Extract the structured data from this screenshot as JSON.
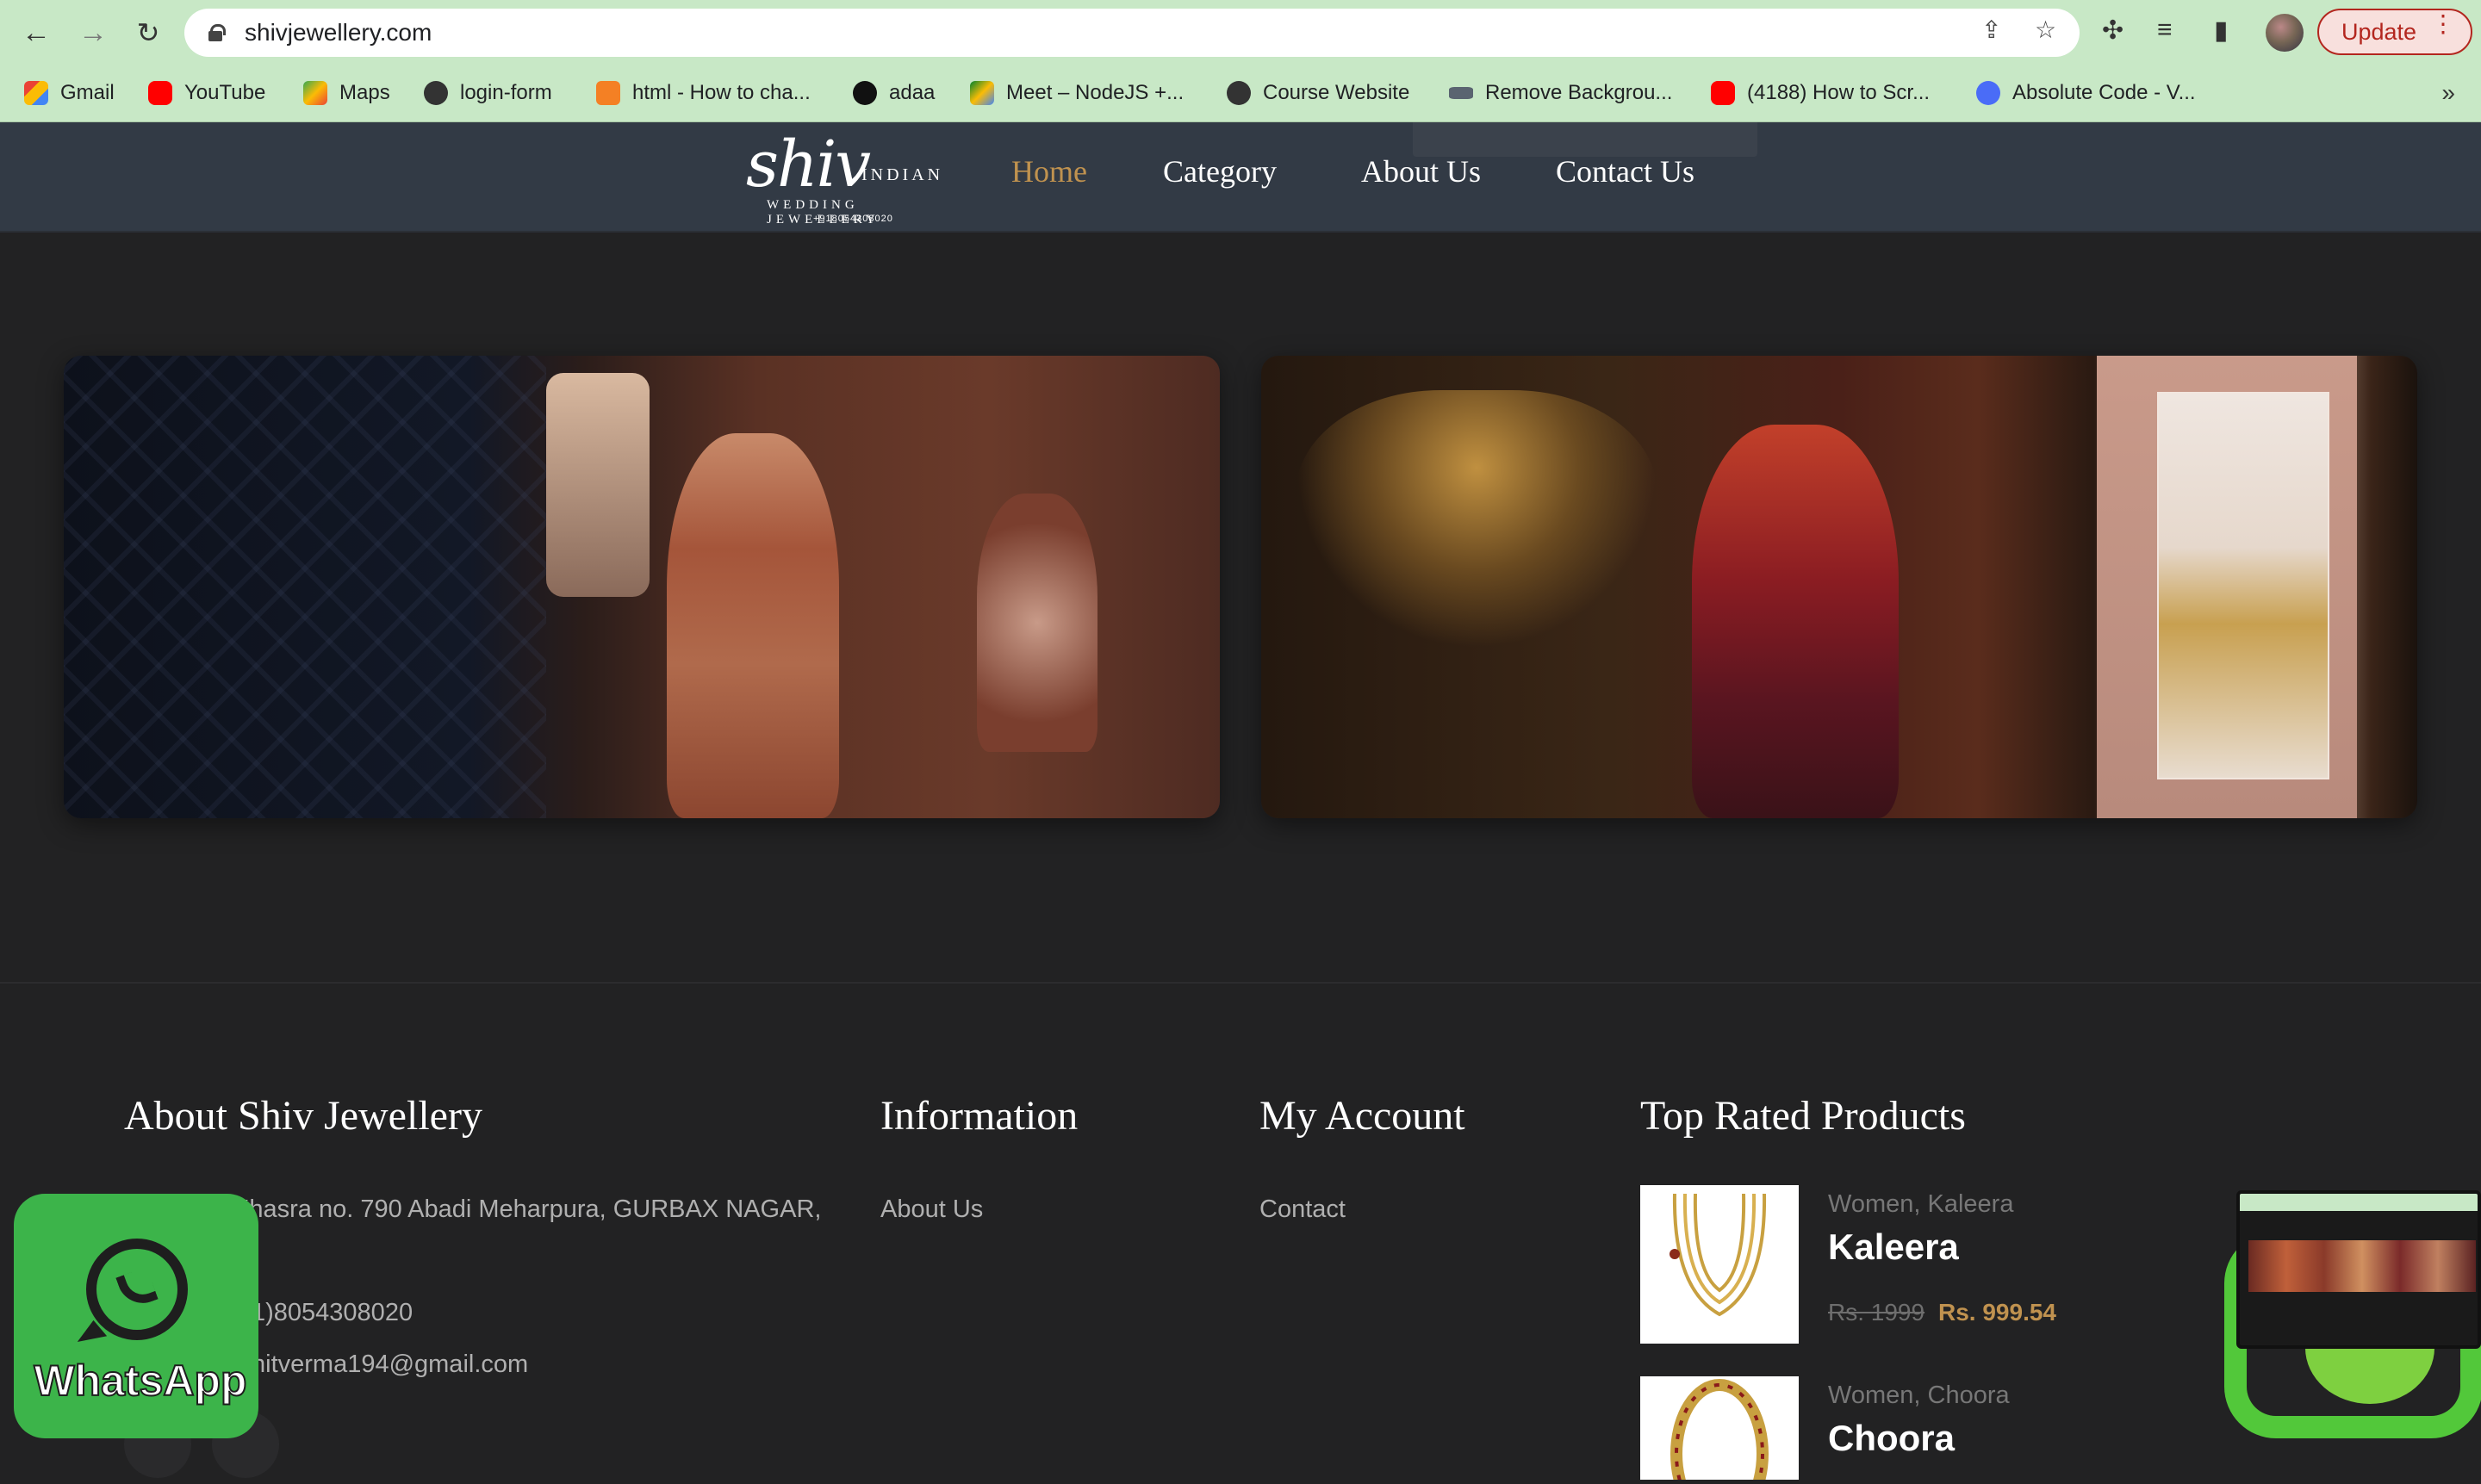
{
  "browser": {
    "url": "shivjewellery.com",
    "update_label": "Update",
    "bookmarks": [
      "Gmail",
      "YouTube",
      "Maps",
      "login-form",
      "html - How to cha...",
      "adaa",
      "Meet – NodeJS +...",
      "Course Website",
      "Remove Backgrou...",
      "(4188) How to Scr...",
      "Absolute Code - V..."
    ],
    "more_bookmarks": "»"
  },
  "site": {
    "logo_script": "shiv",
    "logo_word": "INDIAN",
    "logo_sub": "WEDDING JEWELLERY",
    "logo_phone": "+918054308020",
    "nav": [
      "Home",
      "Category",
      "About Us",
      "Contact Us"
    ],
    "active_nav": "Home"
  },
  "footer": {
    "about_heading": "About Shiv Jewellery",
    "address": "Khasra no. 790 Abadi Meharpura, GURBAX NAGAR,",
    "phone": "1)8054308020",
    "email": "hitverma194@gmail.com",
    "info_heading": "Information",
    "info_links": [
      "About Us"
    ],
    "account_heading": "My Account",
    "account_links": [
      "Contact"
    ],
    "top_heading": "Top Rated Products",
    "products": [
      {
        "category": "Women, Kaleera",
        "name": "Kaleera",
        "old_price": "Rs. 1999",
        "new_price": "Rs. 999.54"
      },
      {
        "category": "Women, Choora",
        "name": "Choora"
      }
    ]
  },
  "whatsapp": {
    "label": "WhatsApp"
  },
  "colors": {
    "accent": "#c0924f",
    "header_bg": "#323a45",
    "page_bg": "#222223",
    "whatsapp": "#3cb44a"
  }
}
